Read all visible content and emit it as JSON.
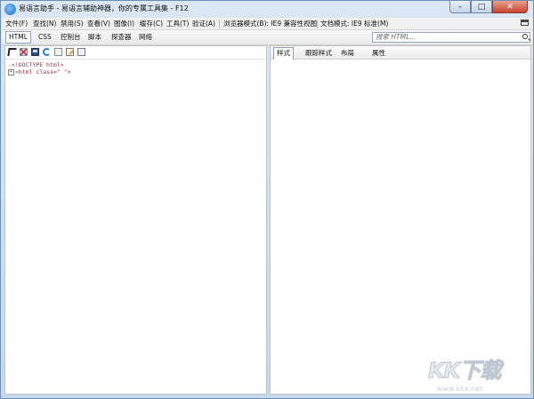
{
  "window": {
    "title": "易语言助手 - 易语言辅助神器，你的专属工具集 - F12",
    "buttons": {
      "minimize": "–",
      "maximize": "□",
      "close": "✕"
    }
  },
  "menubar": {
    "items": [
      "文件(F)",
      "查找(N)",
      "禁用(S)",
      "查看(V)",
      "图像(I)",
      "缓存(C)",
      "工具(T)",
      "验证(A)"
    ],
    "browser_mode_label": "浏览器模式(B):",
    "browser_mode_value": "IE9 兼容性视图",
    "doc_mode_label": "文档模式:",
    "doc_mode_value": "IE9 标准(M)"
  },
  "tabs": [
    "HTML",
    "CSS",
    "控制台",
    "脚本",
    "探查器",
    "网络"
  ],
  "search": {
    "placeholder": "搜索 HTML..."
  },
  "toolbar_icons": [
    "select-element-icon",
    "clear-browser-cache-icon",
    "save-icon",
    "refresh-icon",
    "word-wrap-icon",
    "edit-icon",
    "dom-view-icon"
  ],
  "dom_tree": [
    {
      "text": "<!DOCTYPE html>",
      "prefix": "-",
      "expander": ""
    },
    {
      "text": "<html class=\" \">",
      "prefix": "",
      "expander": "+"
    }
  ],
  "right_tabs": [
    "样式",
    "跟踪样式",
    "布局",
    "属性"
  ],
  "watermark": {
    "main": "KK下载",
    "url": "www.kkx.net"
  },
  "colors": {
    "accent": "#8da2bd",
    "dom_text": "#a0323a",
    "close_button": "#c8452f"
  }
}
